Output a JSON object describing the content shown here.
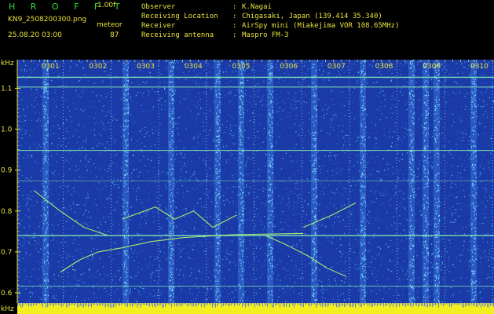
{
  "header": {
    "app_name": "H R O F F T",
    "version": "1.00f",
    "filename": "KN9_2508200300.png",
    "mode_label": "meteor",
    "datetime": "25.08.20 03:00",
    "count": "87",
    "info": [
      {
        "label": "Observer",
        "sep": ":",
        "value": "K.Nagai"
      },
      {
        "label": "Receiving Location",
        "sep": ":",
        "value": "Chigasaki, Japan (139.414 35.340)"
      },
      {
        "label": "Receiver",
        "sep": ":",
        "value": "AirSpy mini (Miakejima VOR 108.65MHz)"
      },
      {
        "label": "Receiving antenna",
        "sep": ":",
        "value": "Maspro FM-3"
      }
    ]
  },
  "spectrogram": {
    "y_unit": "kHz",
    "y_unit_bottom": "kHz",
    "y_ticks": [
      {
        "label": "1.1",
        "value": 1.1
      },
      {
        "label": "1.0",
        "value": 1.0
      },
      {
        "label": "0.9",
        "value": 0.9
      },
      {
        "label": "0.8",
        "value": 0.8
      },
      {
        "label": "0.7",
        "value": 0.7
      },
      {
        "label": "0.6",
        "value": 0.6
      }
    ],
    "y_range": [
      0.575,
      1.17
    ],
    "time_labels": [
      "0301",
      "0302",
      "0303",
      "0304",
      "0305",
      "0306",
      "0307",
      "0308",
      "0309",
      "0310"
    ],
    "colors": {
      "background": "#1a3aa8",
      "axis": "#e8e23c",
      "signal": "#8fffb0",
      "trace": "#b6ff6a",
      "bottom_bar": "#f2ee20"
    }
  }
}
